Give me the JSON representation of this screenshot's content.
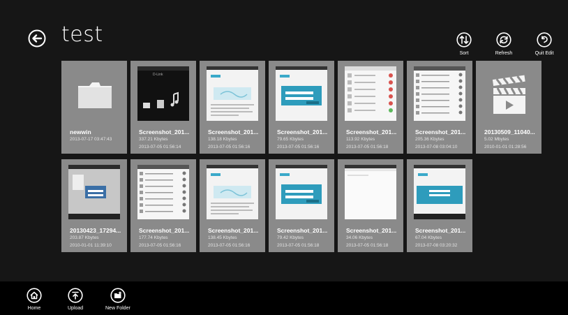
{
  "header": {
    "title": "test"
  },
  "appbar": {
    "sort_label": "Sort",
    "refresh_label": "Refresh",
    "quit_edit_label": "Quit Edit"
  },
  "files": [
    {
      "name": "newwin",
      "size": "",
      "date": "2013-07-17 03:47:43",
      "kind": "folder"
    },
    {
      "name": "Screenshot_201...",
      "size": "337.21 Kbytes",
      "date": "2013-07-05 01:56:14",
      "kind": "media"
    },
    {
      "name": "Screenshot_201...",
      "size": "138.18 Kbytes",
      "date": "2013-07-05 01:56:16",
      "kind": "app-light"
    },
    {
      "name": "Screenshot_201...",
      "size": "79.65 Kbytes",
      "date": "2013-07-05 01:56:16",
      "kind": "app-form"
    },
    {
      "name": "Screenshot_201...",
      "size": "113.92 Kbytes",
      "date": "2013-07-05 01:56:18",
      "kind": "list-red"
    },
    {
      "name": "Screenshot_201...",
      "size": "205.36 Kbytes",
      "date": "2013-07-08 03:04:10",
      "kind": "list"
    },
    {
      "name": "20130509_11040...",
      "size": "5.02 Mbytes",
      "date": "2010-01-01 01:28:56",
      "kind": "video"
    },
    {
      "name": "20130423_17294...",
      "size": "203.87 Kbytes",
      "date": "2010-01-01 11:39:10",
      "kind": "desktop"
    },
    {
      "name": "Screenshot_201...",
      "size": "177.74 Kbytes",
      "date": "2013-07-05 01:56:16",
      "kind": "list"
    },
    {
      "name": "Screenshot_201...",
      "size": "138.45 Kbytes",
      "date": "2013-07-05 01:56:16",
      "kind": "app-light"
    },
    {
      "name": "Screenshot_201...",
      "size": "79.42 Kbytes",
      "date": "2013-07-05 01:56:18",
      "kind": "app-form"
    },
    {
      "name": "Screenshot_201...",
      "size": "34.06 Kbytes",
      "date": "2013-07-05 01:56:18",
      "kind": "blank"
    },
    {
      "name": "Screenshot_201...",
      "size": "67.04 Kbytes",
      "date": "2013-07-08 03:20:32",
      "kind": "app-wide"
    }
  ],
  "bottombar": {
    "home_label": "Home",
    "upload_label": "Upload",
    "new_folder_label": "New Folder"
  },
  "icons": [
    "back-arrow-icon",
    "sort-icon",
    "refresh-icon",
    "quit-edit-icon",
    "folder-icon",
    "video-clapper-icon",
    "home-icon",
    "upload-icon",
    "new-folder-icon"
  ]
}
